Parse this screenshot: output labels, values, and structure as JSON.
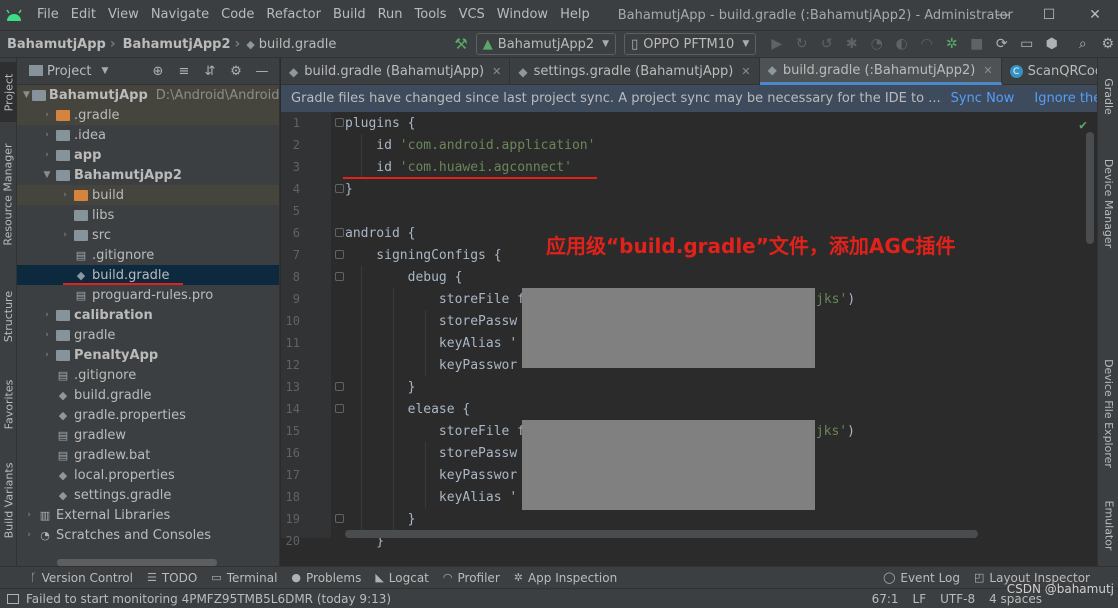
{
  "menu": [
    "File",
    "Edit",
    "View",
    "Navigate",
    "Code",
    "Refactor",
    "Build",
    "Run",
    "Tools",
    "VCS",
    "Window",
    "Help"
  ],
  "window_title": "BahamutjApp - build.gradle (:BahamutjApp2) - Administrator",
  "window_controls": [
    "—",
    "☐",
    "✕"
  ],
  "breadcrumb": [
    "BahamutjApp",
    "BahamutjApp2",
    "build.gradle"
  ],
  "run_config": "BahamutjApp2",
  "device": "OPPO PFTM10",
  "project_panel": {
    "title": "Project",
    "tree": [
      {
        "label": "BahamutjApp",
        "path": "D:\\Android\\AndroidPr",
        "icon": "gray-folder",
        "bold": true
      },
      {
        "label": ".gradle",
        "icon": "orange-folder"
      },
      {
        "label": ".idea",
        "icon": "gray-folder"
      },
      {
        "label": "app",
        "icon": "gray-folder",
        "bold": true
      },
      {
        "label": "BahamutjApp2",
        "icon": "gray-folder",
        "bold": true
      },
      {
        "label": "build",
        "icon": "orange-folder"
      },
      {
        "label": "libs",
        "icon": "gray-folder"
      },
      {
        "label": "src",
        "icon": "gray-folder"
      },
      {
        "label": ".gitignore",
        "icon": "file"
      },
      {
        "label": "build.gradle",
        "icon": "gradle"
      },
      {
        "label": "proguard-rules.pro",
        "icon": "file"
      },
      {
        "label": "calibration",
        "icon": "gray-folder",
        "bold": true
      },
      {
        "label": "gradle",
        "icon": "gray-folder"
      },
      {
        "label": "PenaltyApp",
        "icon": "gray-folder",
        "bold": true
      },
      {
        "label": ".gitignore",
        "icon": "file"
      },
      {
        "label": "build.gradle",
        "icon": "gradle"
      },
      {
        "label": "gradle.properties",
        "icon": "gradle"
      },
      {
        "label": "gradlew",
        "icon": "file"
      },
      {
        "label": "gradlew.bat",
        "icon": "file"
      },
      {
        "label": "local.properties",
        "icon": "gradle"
      },
      {
        "label": "settings.gradle",
        "icon": "gradle"
      },
      {
        "label": "External Libraries",
        "icon": "libs"
      },
      {
        "label": "Scratches and Consoles",
        "icon": "scratch"
      }
    ]
  },
  "left_strip": [
    "Project",
    "Resource Manager",
    "Structure",
    "Favorites",
    "Build Variants"
  ],
  "right_strip": [
    "Gradle",
    "Device Manager",
    "Device File Explorer",
    "Emulator"
  ],
  "tabs": [
    {
      "label": "build.gradle (BahamutjApp)"
    },
    {
      "label": "settings.gradle (BahamutjApp)"
    },
    {
      "label": "build.gradle (:BahamutjApp2)"
    },
    {
      "label": "ScanQRCodeActiv"
    }
  ],
  "banner": {
    "message": "Gradle files have changed since last project sync. A project sync may be necessary for the IDE to ...",
    "sync_now": "Sync Now",
    "ignore": "Ignore these changes"
  },
  "code_lines": [
    {
      "n": "1",
      "text": "plugins {"
    },
    {
      "n": "2",
      "text": "    id ",
      "str": "'com.android.application'"
    },
    {
      "n": "3",
      "text": "    id ",
      "str": "'com.huawei.agconnect'"
    },
    {
      "n": "4",
      "text": "}"
    },
    {
      "n": "5",
      "text": ""
    },
    {
      "n": "6",
      "text": "android {"
    },
    {
      "n": "7",
      "text": "    signingConfigs {"
    },
    {
      "n": "8",
      "text": "        debug {"
    },
    {
      "n": "9",
      "text": "            storeFile f",
      "tail": "jks')"
    },
    {
      "n": "10",
      "text": "            storePassw"
    },
    {
      "n": "11",
      "text": "            keyAlias '"
    },
    {
      "n": "12",
      "text": "            keyPasswor"
    },
    {
      "n": "13",
      "text": "        }"
    },
    {
      "n": "14",
      "text": "        elease {"
    },
    {
      "n": "15",
      "text": "            storeFile f",
      "tail": ".jks')"
    },
    {
      "n": "16",
      "text": "            storePassw"
    },
    {
      "n": "17",
      "text": "            keyPasswor"
    },
    {
      "n": "18",
      "text": "            keyAlias '"
    },
    {
      "n": "19",
      "text": "        }"
    },
    {
      "n": "20",
      "text": "    }"
    }
  ],
  "annotation": "应用级“build.gradle”文件，添加AGC插件",
  "bottom_tools": [
    "Version Control",
    "TODO",
    "Terminal",
    "Problems",
    "Logcat",
    "Profiler",
    "App Inspection"
  ],
  "bottom_tools_right": [
    "Event Log",
    "Layout Inspector"
  ],
  "status": {
    "message": "Failed to start monitoring 4PMFZ95TMB5L6DMR (today 9:13)",
    "position": "67:1",
    "line_sep": "LF",
    "encoding": "UTF-8",
    "indent": "4 spaces"
  },
  "watermark": "CSDN @bahamutj",
  "colors": {
    "accent": "#4a88c7",
    "annotation": "#e2221a",
    "string": "#6a8759",
    "link": "#589df6"
  }
}
